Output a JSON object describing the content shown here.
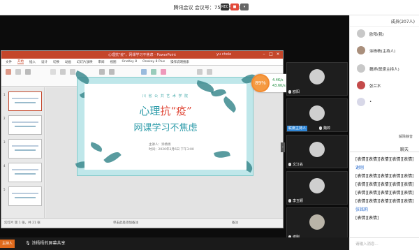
{
  "topbar": {
    "title": "腾讯会议 会议号：754 197 489",
    "rec_label": "REC"
  },
  "ppt": {
    "window_title": "心理抗\"疫\"，网课学习不焦虑 - PowerPoint",
    "user": "yu chole",
    "tabs": [
      "文件",
      "开始",
      "插入",
      "设计",
      "切换",
      "动画",
      "幻灯片放映",
      "审阅",
      "视图",
      "OneKey 8",
      "Onekey 8 Plus",
      "操作说明搜索"
    ],
    "thumb_nums": [
      "1",
      "2",
      "3",
      "4",
      "5"
    ],
    "slide": {
      "school": "川 省 公 共 艺 术 学 院",
      "title_part1": "心理",
      "title_red": "抗“疫”",
      "subtitle": "网课学习不焦虑",
      "presenter": "主讲人：涂杨杨",
      "time": "时间：2020年3月6日 下午3:00"
    },
    "status_left": "幻灯片 第 1 张，共 21 张",
    "status_mid": "单击此处添加备注",
    "status_right": "备注"
  },
  "speed": {
    "percent": "89%",
    "up": "4.4K/s",
    "down": "43.6K/s",
    "rocket": "✈"
  },
  "videos": [
    {
      "name": "欧阳",
      "highlight": ""
    },
    {
      "name": "魏婷",
      "highlight": "联席主持人"
    },
    {
      "name": "文江名",
      "highlight": ""
    },
    {
      "name": "李玉颖",
      "highlight": ""
    },
    {
      "name": "谢刚",
      "highlight": ""
    }
  ],
  "panel": {
    "members_header": "成员(207人)",
    "members": [
      {
        "name": "欧阳(我)"
      },
      {
        "name": "涂杨杨(主持人)"
      },
      {
        "name": "魏婷(联席主持人)"
      },
      {
        "name": "张兰木"
      },
      {
        "name": "•"
      }
    ],
    "unmute_all": "解除静音",
    "chat_tab": "聊天",
    "chat_lines": [
      {
        "text": "[表情][表情][表情][表情][表情]",
        "name": false
      },
      {
        "text": "谢刚",
        "name": true
      },
      {
        "text": "[表情][表情][表情][表情][表情]",
        "name": false
      },
      {
        "text": "[表情][表情][表情][表情][表情]",
        "name": false
      },
      {
        "text": "[表情][表情][表情][表情][表情]",
        "name": false
      },
      {
        "text": "[表情][表情][表情][表情][表情]",
        "name": false
      },
      {
        "text": "张铭莉",
        "name": true
      },
      {
        "text": "[表情][表情]",
        "name": false
      }
    ],
    "input_placeholder": "请输入消息..."
  },
  "bottombar": {
    "host_label": "主持人",
    "share_text": "涂杨杨的屏幕共享"
  },
  "colors": {
    "ppt_accent": "#c4462a",
    "speed_ring": "#f28a2f",
    "link_blue": "#2f6fcf",
    "host_orange": "#e06a1c"
  }
}
